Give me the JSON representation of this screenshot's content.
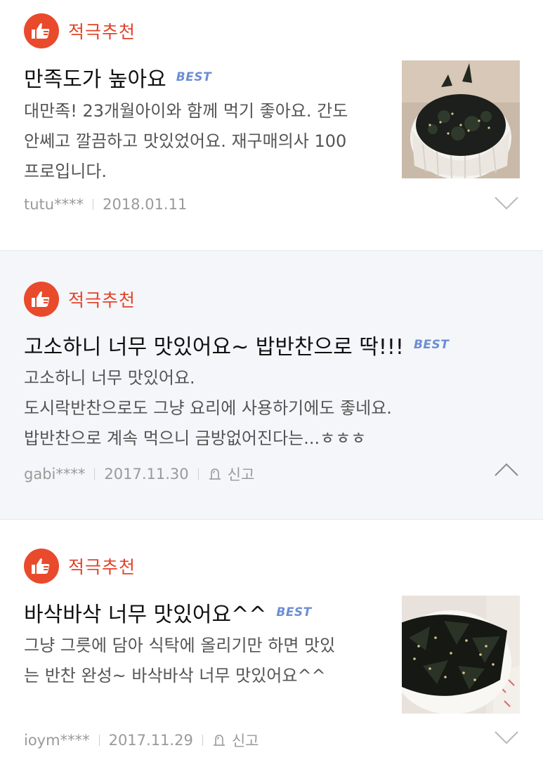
{
  "reviews": [
    {
      "badge_label": "적극추천",
      "title": "만족도가 높아요",
      "best_label": "BEST",
      "body_lines": [
        "대만족! 23개월아이와 함께 먹기 좋아요. 간도",
        "안쎄고 깔끔하고 맛있었어요. 재구매의사 100",
        "프로입니다."
      ],
      "author": "tutu****",
      "date": "2018.01.11",
      "expanded": false
    },
    {
      "badge_label": "적극추천",
      "title": "고소하니 너무 맛있어요~ 밥반찬으로 딱!!!",
      "best_label": "BEST",
      "body_lines": [
        "고소하니 너무 맛있어요.",
        "도시락반찬으로도 그냥 요리에 사용하기에도 좋네요.",
        "밥반찬으로 계속 먹으니 금방없어진다는...ㅎㅎㅎ"
      ],
      "author": "gabi****",
      "date": "2017.11.30",
      "report_label": "신고",
      "expanded": true
    },
    {
      "badge_label": "적극추천",
      "title": "바삭바삭 너무 맛있어요^^",
      "best_label": "BEST",
      "body_lines": [
        "그냥 그릇에 담아 식탁에 올리기만 하면 맛있",
        "는 반찬 완성~ 바삭바삭 너무 맛있어요^^"
      ],
      "author": "ioym****",
      "date": "2017.11.29",
      "report_label": "신고",
      "expanded": false
    }
  ],
  "colors": {
    "accent": "#e94a2c",
    "best": "#6c8ed3",
    "expanded_bg": "#f4f6f9"
  },
  "icons": {
    "badge": "thumbs-up-icon",
    "report": "siren-icon",
    "collapse": "chevron-up-icon",
    "expand": "chevron-down-icon"
  }
}
